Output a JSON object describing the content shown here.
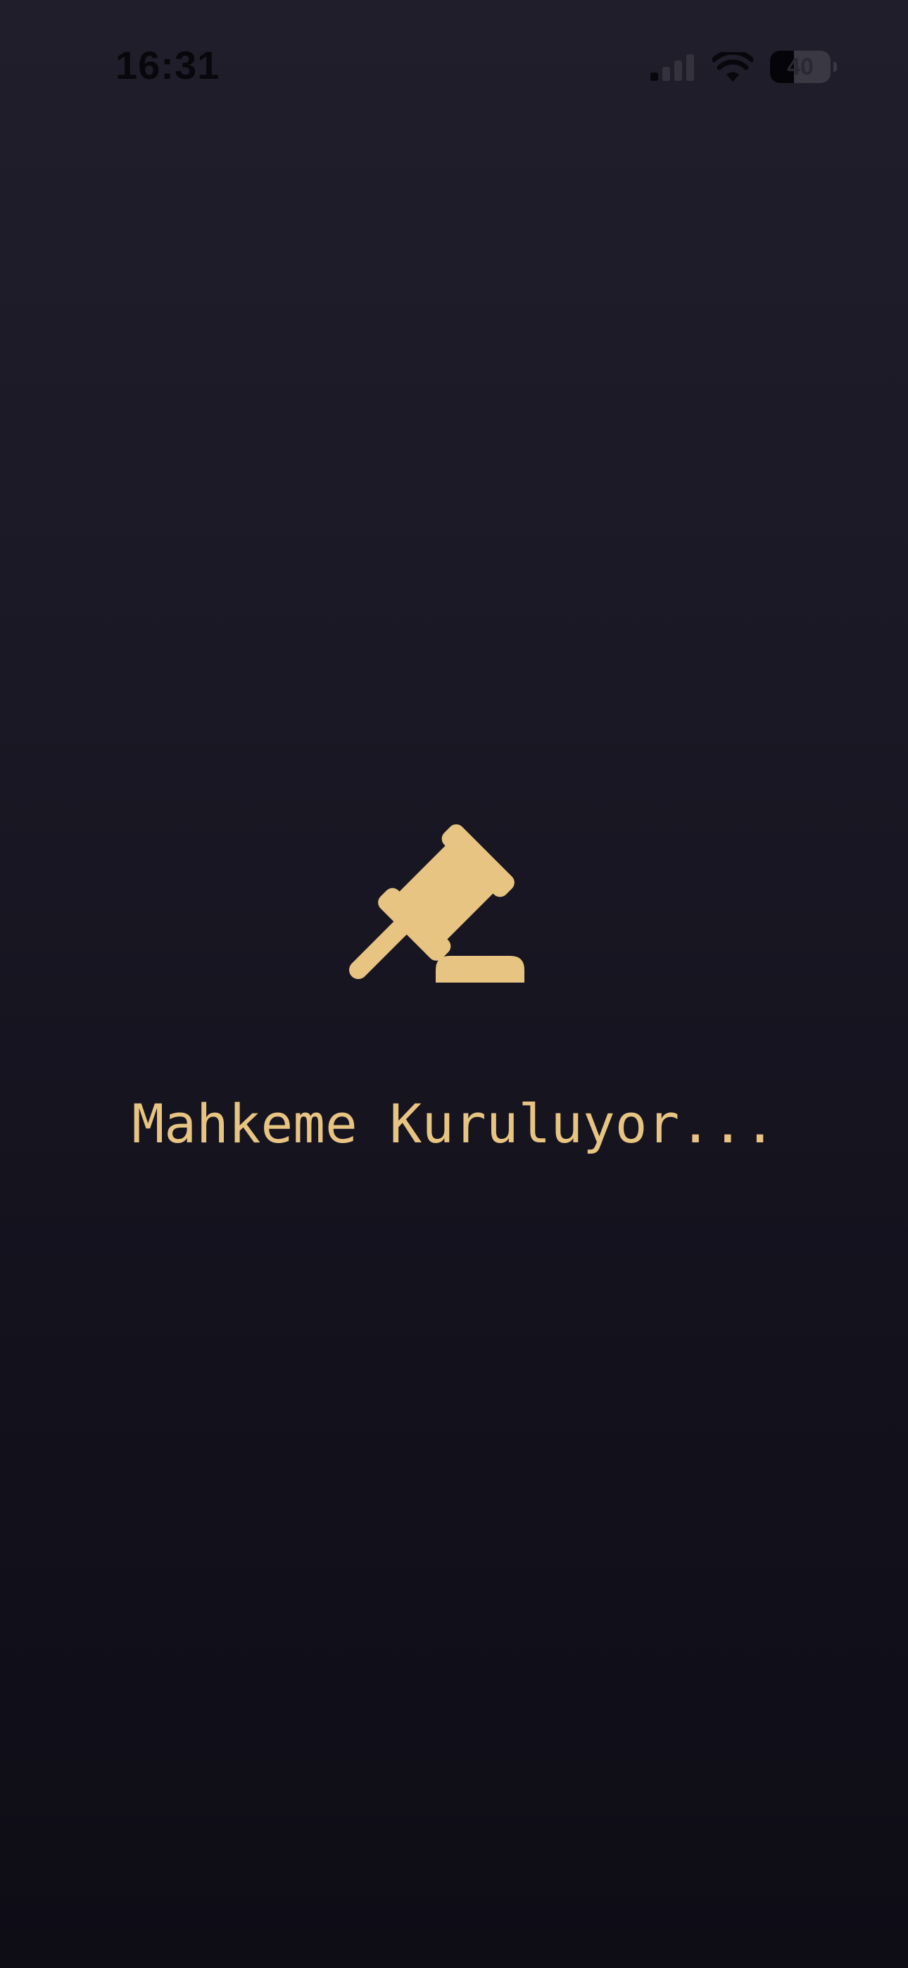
{
  "status_bar": {
    "time": "16:31",
    "battery_level": "40",
    "signal_bars_active": 1,
    "signal_bars_total": 4
  },
  "loading": {
    "icon": "gavel-icon",
    "message": "Mahkeme Kuruluyor..."
  },
  "colors": {
    "accent_gold": "#e8c482",
    "background_top": "#201e2a",
    "background_bottom": "#0e0c15"
  }
}
